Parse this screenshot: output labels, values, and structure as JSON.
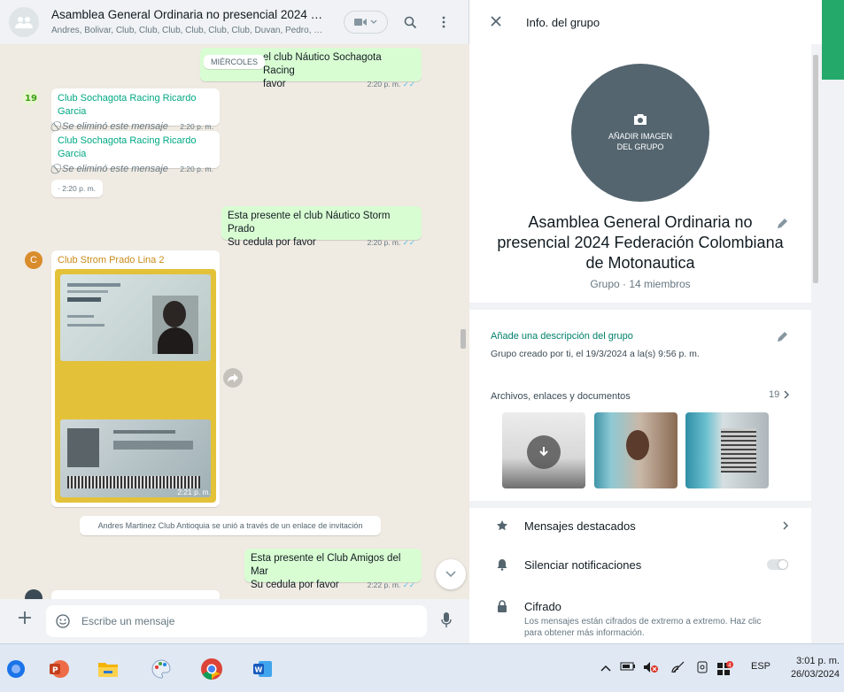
{
  "chat": {
    "header": {
      "title": "Asamblea General Ordinaria no presencial 2024 Feder...",
      "members": "Andres, Bolivar, Club, Club, Club, Club, Club, Club, Duvan, Pedro, Re..."
    },
    "day_chip": "MIÉRCOLES",
    "messages": [
      {
        "id": "m1",
        "type": "out",
        "text_line1": "el club Náutico Sochagota Racing",
        "text_line2": "favor",
        "time": "2:20 p. m."
      },
      {
        "id": "m2",
        "type": "in",
        "sender": "Club Sochagota Racing Ricardo Garcia",
        "text": "Se eliminó este mensaje",
        "time": "2:20 p. m."
      },
      {
        "id": "m3",
        "type": "in",
        "sender": "Club Sochagota Racing Ricardo Garcia",
        "text": "Se eliminó este mensaje",
        "time": "2:20 p. m."
      },
      {
        "id": "m4",
        "type": "in",
        "text": "·",
        "time": "2:20 p. m."
      },
      {
        "id": "m5",
        "type": "out",
        "text_line1": "Esta presente el club Náutico Storm Prado",
        "text_line2": "Su cedula por favor",
        "time": "2:20 p. m."
      },
      {
        "id": "m6",
        "type": "in-image",
        "sender": "Club Strom Prado Lina 2",
        "time": "2:21 p. m."
      },
      {
        "id": "m8",
        "type": "out",
        "text_line1": "Esta presente el Club Amigos del Mar",
        "text_line2": "Su cedula por favor",
        "time": "2:22 p. m."
      }
    ],
    "system_notice": "Andres Martinez Club Antioquia se unió a través de un enlace de invitación",
    "sender_badge": "19",
    "sender_initial": "C",
    "composer": {
      "placeholder": "Escribe un mensaje"
    }
  },
  "info": {
    "title": "Info. del grupo",
    "add_photo": "AÑADIR IMAGEN DEL GRUPO",
    "group_name": "Asamblea General Ordinaria no presencial 2024 Federación Colombiana de Motonautica",
    "group_sub": "Grupo · 14 miembros",
    "description_link": "Añade una descripción del grupo",
    "created": "Grupo creado por ti, el 19/3/2024 a la(s) 9:56 p. m.",
    "media_label": "Archivos, enlaces y documentos",
    "media_count": "19",
    "rows": {
      "starred": "Mensajes destacados",
      "mute": "Silenciar notificaciones",
      "encryption": "Cifrado",
      "encryption_sub": "Los mensajes están cifrados de extremo a extremo. Haz clic para obtener más información."
    }
  },
  "taskbar": {
    "language": "ESP",
    "time": "3:01 p. m.",
    "date": "26/03/2024",
    "badge": "4"
  },
  "colors": {
    "accent": "#008069",
    "outgoing": "#d9fdd3",
    "chat_bg": "#efeae2",
    "strip": "#25a96b"
  }
}
